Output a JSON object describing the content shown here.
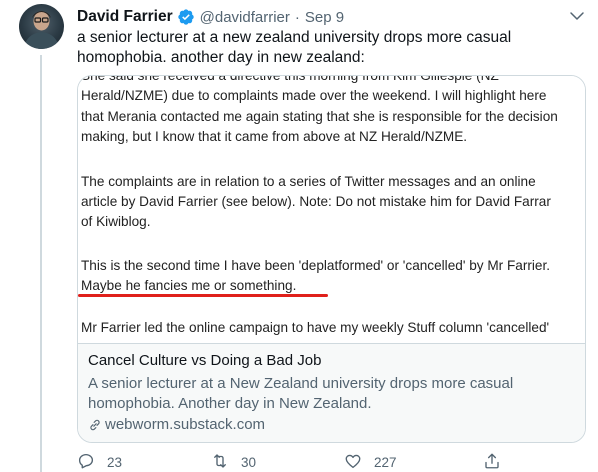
{
  "author": {
    "display_name": "David Farrier",
    "handle": "@davidfarrier",
    "separator": "·",
    "time": "Sep 9",
    "verified": true
  },
  "tweet": {
    "text": "a senior lecturer at a new zealand university drops more casual homophobia. another day in new zealand:"
  },
  "card": {
    "image_lines": [
      "She said she received a directive this morning from Kim Gillespie (NZ",
      "Herald/NZME) due to complaints made over the weekend. I will highlight here",
      "that Merania contacted me again stating that she is responsible for the decision",
      "making, but I know that it came from above at NZ Herald/NZME.",
      "The complaints are in relation to a series of Twitter messages and an online",
      "article by David Farrier (see below). Note: Do not mistake him for David Farrar",
      "of Kiwiblog.",
      "This is the second time I have been 'deplatformed' or 'cancelled' by Mr Farrier.",
      "Maybe he fancies me or something.",
      "Mr Farrier led the online campaign to have my weekly Stuff column 'cancelled'"
    ],
    "underline_color": "#e0201b",
    "title": "Cancel Culture vs Doing a Bad Job",
    "description": "A senior lecturer at a New Zealand university drops more casual homophobia. Another day in New Zealand.",
    "domain": "webworm.substack.com"
  },
  "actions": {
    "reply_count": "23",
    "retweet_count": "30",
    "like_count": "227"
  },
  "icons": {
    "verified": "verified-badge-icon",
    "caret": "chevron-down-icon",
    "link": "link-icon",
    "reply": "reply-icon",
    "retweet": "retweet-icon",
    "like": "heart-icon",
    "share": "share-icon"
  },
  "colors": {
    "verified": "#1d9bf0",
    "secondary_text": "#536471",
    "card_border": "#cfd9de"
  }
}
